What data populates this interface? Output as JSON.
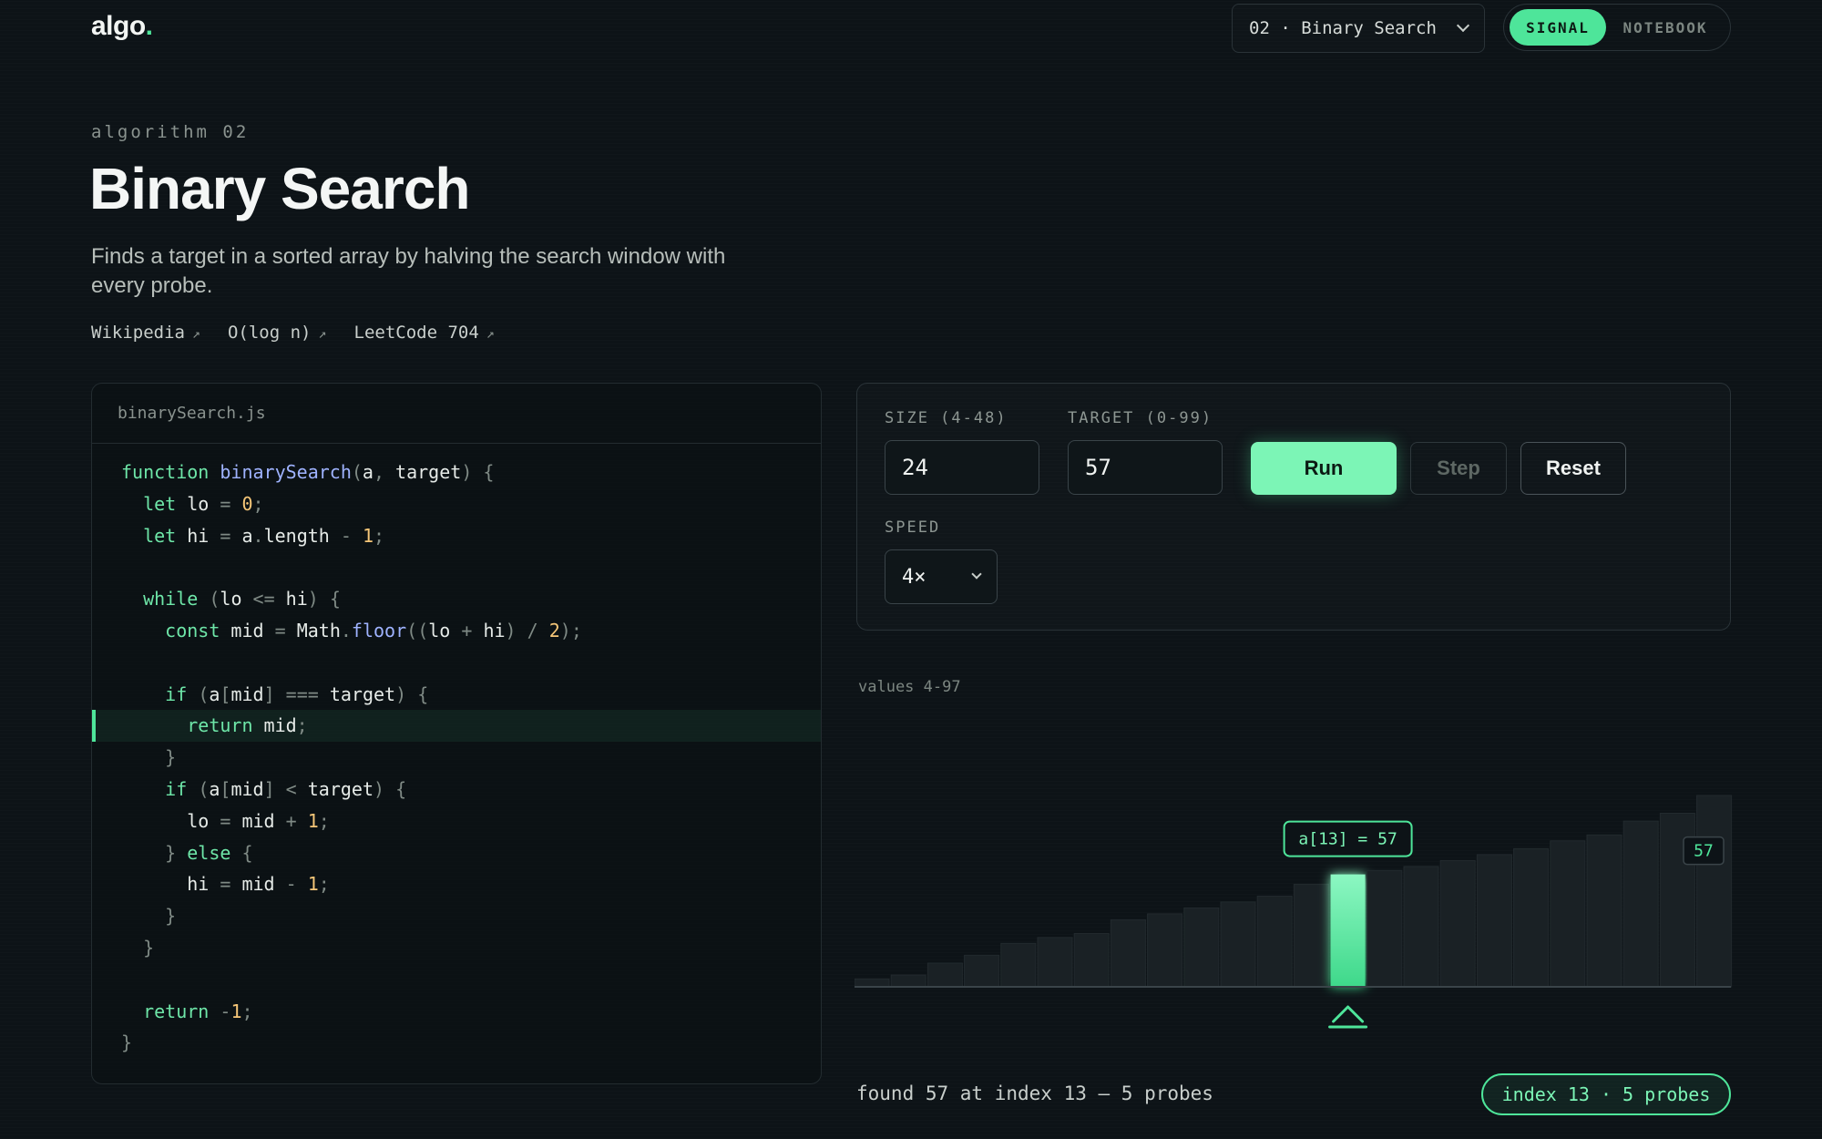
{
  "header": {
    "logo": "algo",
    "logo_dot": ".",
    "algorithm_select": "02 · Binary Search",
    "mode_signal": "SIGNAL",
    "mode_notebook": "NOTEBOOK",
    "active_mode": "SIGNAL"
  },
  "hero": {
    "kicker": "algorithm 02",
    "title": "Binary Search",
    "description": "Finds a target in a sorted array by halving the search window with every probe.",
    "links": [
      {
        "label": "Wikipedia",
        "arrow": "↗"
      },
      {
        "label": "O(log n)",
        "arrow": "↗"
      },
      {
        "label": "LeetCode 704",
        "arrow": "↗"
      }
    ]
  },
  "code": {
    "filename": "binarySearch.js",
    "highlighted_line": 9,
    "lines": [
      "function binarySearch(a, target) {",
      "  let lo = 0;",
      "  let hi = a.length - 1;",
      "",
      "  while (lo <= hi) {",
      "    const mid = Math.floor((lo + hi) / 2);",
      "",
      "    if (a[mid] === target) {",
      "      return mid;",
      "    }",
      "    if (a[mid] < target) {",
      "      lo = mid + 1;",
      "    } else {",
      "      hi = mid - 1;",
      "    }",
      "  }",
      "",
      "  return -1;",
      "}"
    ]
  },
  "controls": {
    "size_label": "SIZE (4-48)",
    "size_value": "24",
    "target_label": "TARGET (0-99)",
    "target_value": "57",
    "run_label": "Run",
    "step_label": "Step",
    "reset_label": "Reset",
    "speed_label": "SPEED",
    "speed_value": "4×"
  },
  "visualization": {
    "range_label": "values 4-97",
    "probe_label": "a[13] = 57",
    "target_tag": "57",
    "found_index": 13,
    "target_value": 57,
    "max_value": 97,
    "values": [
      4,
      6,
      12,
      16,
      22,
      25,
      27,
      34,
      37,
      40,
      43,
      46,
      52,
      57,
      59,
      61,
      64,
      67,
      70,
      74,
      77,
      84,
      88,
      97
    ],
    "colors": {
      "accent": "#4ee59a",
      "bar": "#1a2125",
      "bar_edge": "#222a2e",
      "baseline": "#3a4449"
    }
  },
  "status": {
    "message": "found 57 at index 13 — 5 probes",
    "badge": "index 13 · 5 probes"
  }
}
